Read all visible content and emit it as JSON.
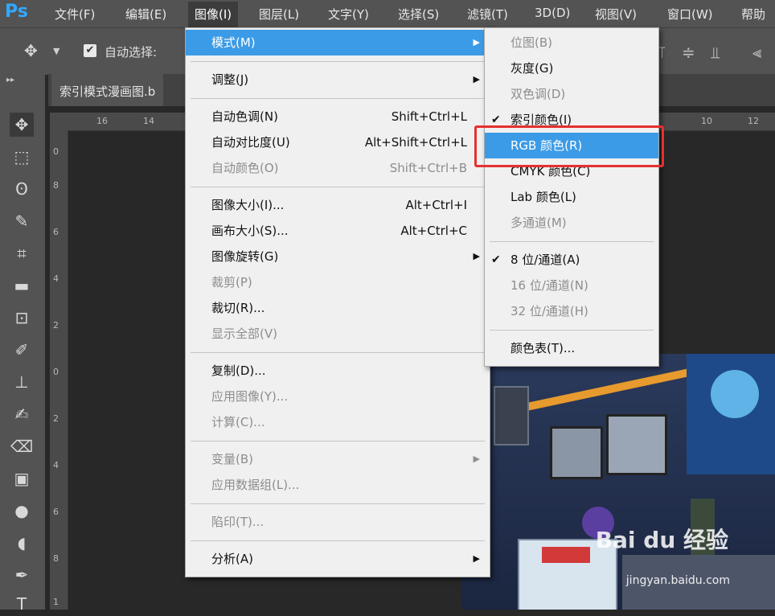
{
  "app": {
    "logo": "Ps"
  },
  "menubar": [
    {
      "label": "文件(F)"
    },
    {
      "label": "编辑(E)"
    },
    {
      "label": "图像(I)"
    },
    {
      "label": "图层(L)"
    },
    {
      "label": "文字(Y)"
    },
    {
      "label": "选择(S)"
    },
    {
      "label": "滤镜(T)"
    },
    {
      "label": "3D(D)"
    },
    {
      "label": "视图(V)"
    },
    {
      "label": "窗口(W)"
    },
    {
      "label": "帮助"
    }
  ],
  "options": {
    "auto_select_label": "自动选择:"
  },
  "document": {
    "tab_title": "索引模式漫画图.b"
  },
  "rulers": {
    "h": [
      "16",
      "14",
      "10",
      "12"
    ],
    "v": [
      "0",
      "8",
      "6",
      "4",
      "2",
      "0",
      "2",
      "4",
      "6",
      "8",
      "1"
    ]
  },
  "image_menu": [
    {
      "label": "模式(M)",
      "submenu": true,
      "highlight": true
    },
    {
      "sep": true
    },
    {
      "label": "调整(J)",
      "submenu": true
    },
    {
      "sep": true
    },
    {
      "label": "自动色调(N)",
      "shortcut": "Shift+Ctrl+L"
    },
    {
      "label": "自动对比度(U)",
      "shortcut": "Alt+Shift+Ctrl+L"
    },
    {
      "label": "自动颜色(O)",
      "shortcut": "Shift+Ctrl+B",
      "disabled": true
    },
    {
      "sep": true
    },
    {
      "label": "图像大小(I)...",
      "shortcut": "Alt+Ctrl+I"
    },
    {
      "label": "画布大小(S)...",
      "shortcut": "Alt+Ctrl+C"
    },
    {
      "label": "图像旋转(G)",
      "submenu": true
    },
    {
      "label": "裁剪(P)",
      "disabled": true
    },
    {
      "label": "裁切(R)..."
    },
    {
      "label": "显示全部(V)",
      "disabled": true
    },
    {
      "sep": true
    },
    {
      "label": "复制(D)..."
    },
    {
      "label": "应用图像(Y)...",
      "disabled": true
    },
    {
      "label": "计算(C)...",
      "disabled": true
    },
    {
      "sep": true
    },
    {
      "label": "变量(B)",
      "submenu": true,
      "disabled": true
    },
    {
      "label": "应用数据组(L)...",
      "disabled": true
    },
    {
      "sep": true
    },
    {
      "label": "陷印(T)...",
      "disabled": true
    },
    {
      "sep": true
    },
    {
      "label": "分析(A)",
      "submenu": true
    }
  ],
  "mode_submenu": [
    {
      "label": "位图(B)",
      "disabled": true
    },
    {
      "label": "灰度(G)"
    },
    {
      "label": "双色调(D)",
      "disabled": true
    },
    {
      "label": "索引颜色(I)",
      "checked": true
    },
    {
      "label": "RGB 颜色(R)",
      "highlight": true
    },
    {
      "label": "CMYK 颜色(C)"
    },
    {
      "label": "Lab 颜色(L)"
    },
    {
      "label": "多通道(M)",
      "disabled": true
    },
    {
      "sep": true
    },
    {
      "label": "8 位/通道(A)",
      "checked": true
    },
    {
      "label": "16 位/通道(N)",
      "disabled": true
    },
    {
      "label": "32 位/通道(H)",
      "disabled": true
    },
    {
      "sep": true
    },
    {
      "label": "颜色表(T)..."
    }
  ],
  "watermark": {
    "brand": "Bai du 经验",
    "url": "jingyan.baidu.com"
  },
  "colors": {
    "accent": "#3c9be6",
    "highlight_box": "#e53030",
    "ps_blue": "#31a8ff"
  }
}
